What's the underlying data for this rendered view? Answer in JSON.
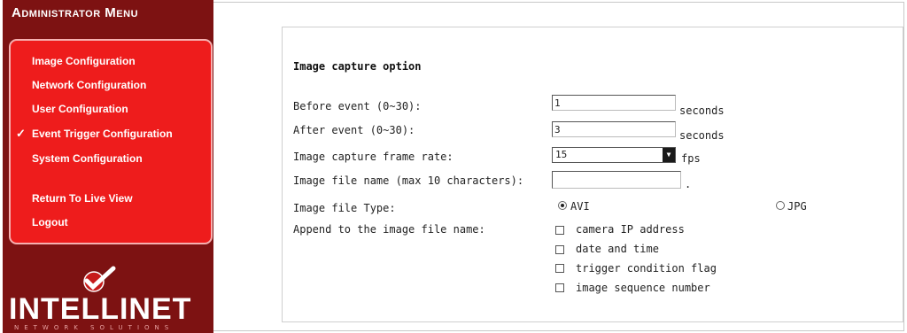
{
  "sidebar": {
    "title": "Administrator Menu",
    "items": [
      {
        "label": "Image Configuration",
        "active": false
      },
      {
        "label": "Network Configuration",
        "active": false
      },
      {
        "label": "User Configuration",
        "active": false
      },
      {
        "label": "Event Trigger Configuration",
        "active": true
      },
      {
        "label": "System Configuration",
        "active": false
      },
      {
        "label": "Return To Live View",
        "active": false
      },
      {
        "label": "Logout",
        "active": false
      }
    ],
    "check_mark": "✓",
    "logo_text": "INTELLINET",
    "logo_sub": "NETWORK SOLUTIONS",
    "logo_icon": "checkmark-logo-icon"
  },
  "form": {
    "title": "Image capture option",
    "before_event": {
      "label": "Before event (0~30):",
      "value": "1",
      "unit": "seconds"
    },
    "after_event": {
      "label": "After event (0~30):",
      "value": "3",
      "unit": "seconds"
    },
    "frame_rate": {
      "label": "Image capture frame rate:",
      "value": "15",
      "unit": "fps"
    },
    "file_name": {
      "label": "Image file name (max 10 characters):",
      "value": "",
      "suffix": "."
    },
    "file_type": {
      "label": "Image file Type:",
      "options": [
        "AVI",
        "JPG"
      ],
      "selected": "AVI"
    },
    "append": {
      "label": "Append to the image file name:",
      "options": [
        "camera IP address",
        "date and time",
        "trigger condition flag",
        "image sequence number"
      ]
    }
  },
  "colors": {
    "sidebar_dark": "#7d1212",
    "menu_red": "#ee1c1c"
  }
}
